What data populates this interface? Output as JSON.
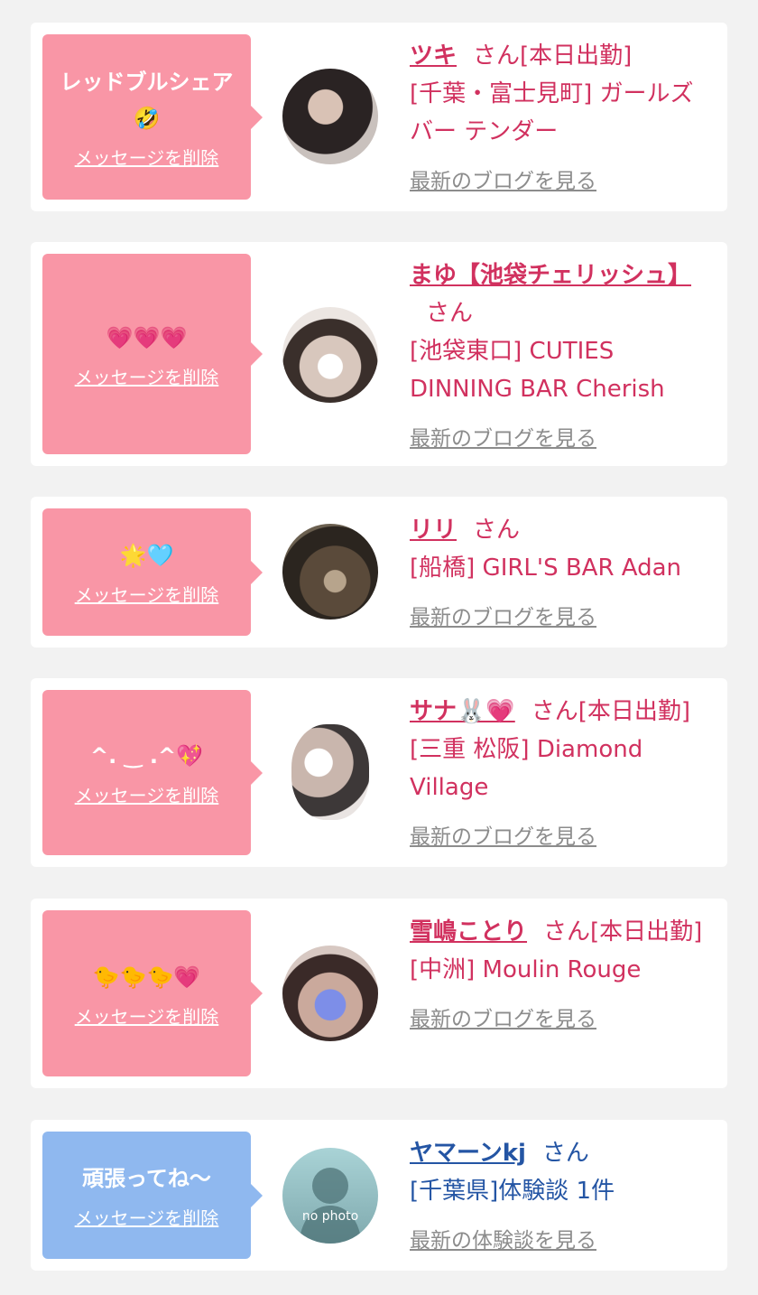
{
  "cards": [
    {
      "message": "レッドブルシェア🤣",
      "delete_label": "メッセージを削除",
      "name": "ツキ",
      "san": "さん",
      "status": "[本日出勤]",
      "shop": "[千葉・富士見町] ガールズバー テンダー",
      "blog_label": "最新のブログを見る"
    },
    {
      "message": "💗💗💗",
      "delete_label": "メッセージを削除",
      "name": "まゆ【池袋チェリッシュ】",
      "san": "さん",
      "status": "",
      "shop": "[池袋東口] CUTIES DINNING BAR Cherish",
      "blog_label": "最新のブログを見る"
    },
    {
      "message": "🌟🩵",
      "delete_label": "メッセージを削除",
      "name": "リリ",
      "san": "さん",
      "status": "",
      "shop": "[船橋] GIRL'S BAR Adan",
      "blog_label": "最新のブログを見る"
    },
    {
      "message": "^. ‿ .^💖",
      "delete_label": "メッセージを削除",
      "name": "サナ🐰💗",
      "san": "さん",
      "status": "[本日出勤]",
      "shop": "[三重 松阪] Diamond Village",
      "blog_label": "最新のブログを見る"
    },
    {
      "message": "🐤🐤🐤💗",
      "delete_label": "メッセージを削除",
      "name": "雪嶋ことり",
      "san": "さん",
      "status": "[本日出勤]",
      "shop": "[中洲] Moulin Rouge",
      "blog_label": "最新のブログを見る"
    },
    {
      "message": "頑張ってね〜",
      "delete_label": "メッセージを削除",
      "name": "ヤマーンkj",
      "san": "さん",
      "status": "",
      "shop": "[千葉県]体験談 1件",
      "blog_label": "最新の体験談を見る",
      "avatar_label": "no photo"
    }
  ],
  "colors": {
    "background": "#f2f2f2",
    "pink_bubble": "#f996a6",
    "blue_bubble": "#8fb8ef",
    "pink_text": "#d1315f",
    "blue_text": "#2455a4",
    "link_gray": "#8c8c8c"
  },
  "icons": {
    "avatar": "profile-photo",
    "no_photo_avatar": "silhouette-icon"
  }
}
